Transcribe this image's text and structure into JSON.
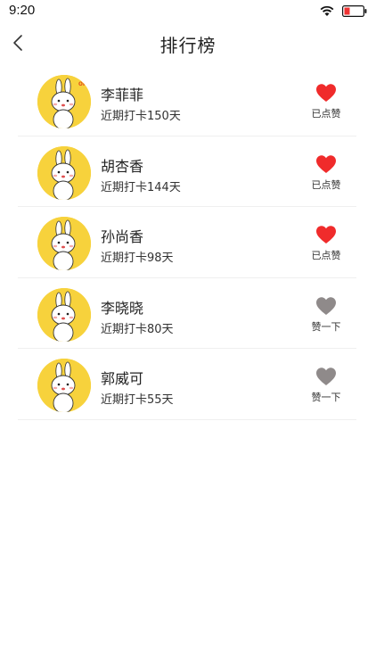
{
  "status_bar": {
    "time": "9:20"
  },
  "nav": {
    "title": "排行榜"
  },
  "colors": {
    "liked": "#f02b2b",
    "unliked": "#8f8a8a",
    "avatar_bg": "#f7d23c"
  },
  "ranking": [
    {
      "name": "李菲菲",
      "streak": "近期打卡150天",
      "like_label": "已点赞",
      "liked": true,
      "avatar_badge": "ok"
    },
    {
      "name": "胡杏香",
      "streak": "近期打卡144天",
      "like_label": "已点赞",
      "liked": true,
      "avatar_badge": ""
    },
    {
      "name": "孙尚香",
      "streak": "近期打卡98天",
      "like_label": "已点赞",
      "liked": true,
      "avatar_badge": ""
    },
    {
      "name": "李晓晓",
      "streak": "近期打卡80天",
      "like_label": "赞一下",
      "liked": false,
      "avatar_badge": ""
    },
    {
      "name": "郭威可",
      "streak": "近期打卡55天",
      "like_label": "赞一下",
      "liked": false,
      "avatar_badge": ""
    }
  ]
}
